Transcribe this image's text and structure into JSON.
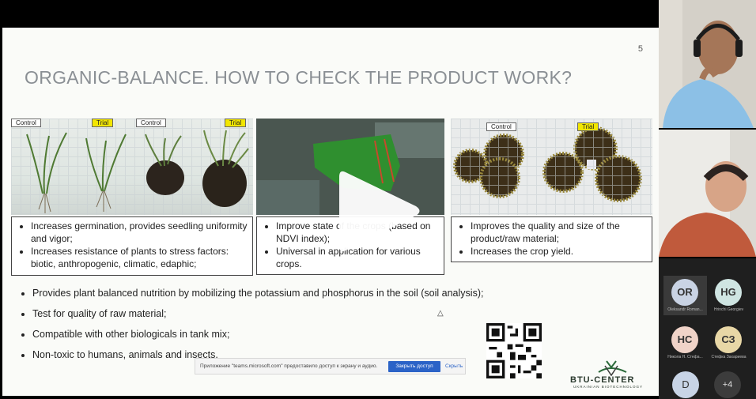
{
  "slide": {
    "number": "5",
    "title": "ORGANIC-BALANCE. HOW TO CHECK THE PRODUCT WORK?",
    "photo_labels": {
      "control_1": "Control",
      "trial_1": "Trial",
      "control_2": "Control",
      "trial_2": "Trial",
      "control_3": "Control",
      "trial_3": "Trial"
    },
    "box1": [
      "Increases germination, provides seedling uniformity and vigor;",
      "Increases resistance of plants to stress factors: biotic, anthropogenic, climatic, edaphic;"
    ],
    "box2": [
      "Improve state of the crops (based on NDVI index);",
      "Universal in application for various crops."
    ],
    "box3": [
      "Improves the quality and size of the product/raw material;",
      "Increases the crop yield."
    ],
    "bullets": [
      "Provides plant balanced nutrition by mobilizing the potassium and phosphorus in the soil (soil analysis);",
      "Test for quality of raw material;",
      "Compatible with other biologicals in tank mix;",
      "Non-toxic to humans, animals and insects."
    ],
    "logo": {
      "name": "BTU-CENTER",
      "tagline": "UKRAINIAN BIOTECHNOLOGY"
    }
  },
  "notification": {
    "text": "Приложение \"teams.microsoft.com\" предоставило доступ к экрану и аудио.",
    "stop_label": "Закрыть доступ",
    "hide_label": "Скрыть"
  },
  "participants": [
    {
      "initials": "OR",
      "name": "Oleksandr Roman...",
      "color": "#c9d3e4"
    },
    {
      "initials": "HG",
      "name": "Hrinchi Georgiev",
      "color": "#cfe5e2"
    },
    {
      "initials": "HC",
      "name": "Никола Н. Стефа...",
      "color": "#f0d3c8"
    },
    {
      "initials": "СЗ",
      "name": "Стефка Захариева",
      "color": "#e8d7a6"
    },
    {
      "initials": "D",
      "name": "",
      "color": "#c8d4e6"
    }
  ],
  "more_count": "+4",
  "colors": {
    "trial_tag": "#f2e600",
    "share_button": "#2b63c7",
    "title": "#8a8f94"
  }
}
